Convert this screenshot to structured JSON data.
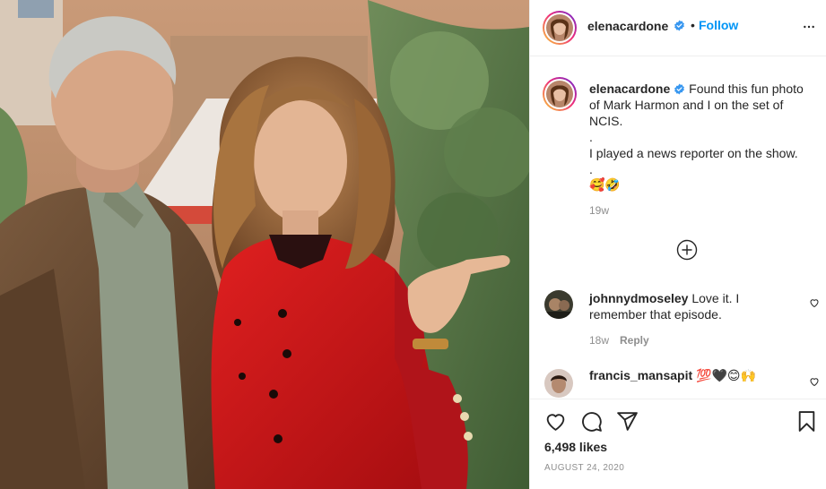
{
  "post": {
    "author": {
      "username": "elenacardone",
      "verified": true,
      "follow_label": "Follow",
      "separator": "•"
    },
    "caption": {
      "username": "elenacardone",
      "text": "Found this fun photo of Mark Harmon and I on the set of NCIS.\n.\nI played a news reporter on the show.\n.",
      "emojis": "🥰🤣",
      "time": "19w"
    },
    "comments": [
      {
        "username": "johnnydmoseley",
        "text": "Love it. I remember that episode.",
        "time": "18w",
        "reply_label": "Reply"
      },
      {
        "username": "francis_mansapit",
        "text": "💯🖤😊🙌",
        "time": "",
        "reply_label": ""
      }
    ],
    "likes": "6,498 likes",
    "date": "AUGUST 24, 2020"
  },
  "icons": {
    "more": "more-options-icon",
    "verified": "verified-badge-icon",
    "load_more": "plus-circle-icon",
    "like": "heart-icon",
    "comment": "comment-icon",
    "share": "paper-plane-icon",
    "save": "bookmark-icon"
  },
  "colors": {
    "accent": "#0095f6",
    "text": "#262626",
    "muted": "#8e8e8e",
    "border": "#efefef"
  }
}
